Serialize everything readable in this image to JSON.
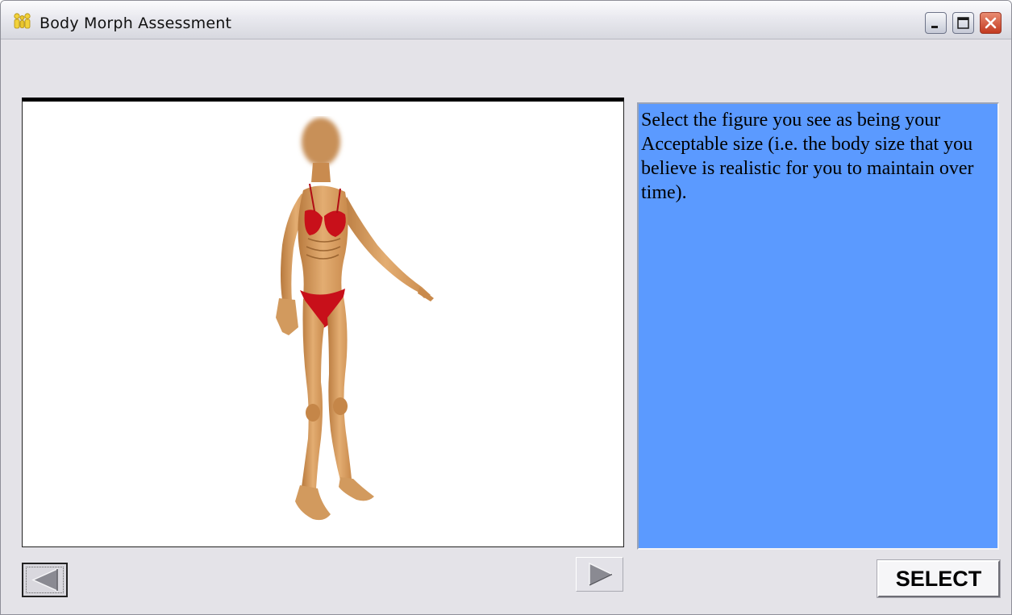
{
  "window": {
    "title": "Body Morph Assessment",
    "icon": "people-icon",
    "controls": [
      "minimize-icon",
      "maximize-icon",
      "close-icon"
    ]
  },
  "viewer": {
    "image": "body-figure-image",
    "figure_colors": {
      "skin": "#d9a064",
      "swimsuit": "#c8101a"
    }
  },
  "instructions": {
    "text": "Select the figure you see as being your Acceptable size (i.e. the body size that you believe is realistic for you to maintain over time).",
    "background": "#5b9aff"
  },
  "navigation": {
    "prev_icon": "left-triangle-icon",
    "next_icon": "right-triangle-icon"
  },
  "actions": {
    "select_label": "SELECT"
  }
}
